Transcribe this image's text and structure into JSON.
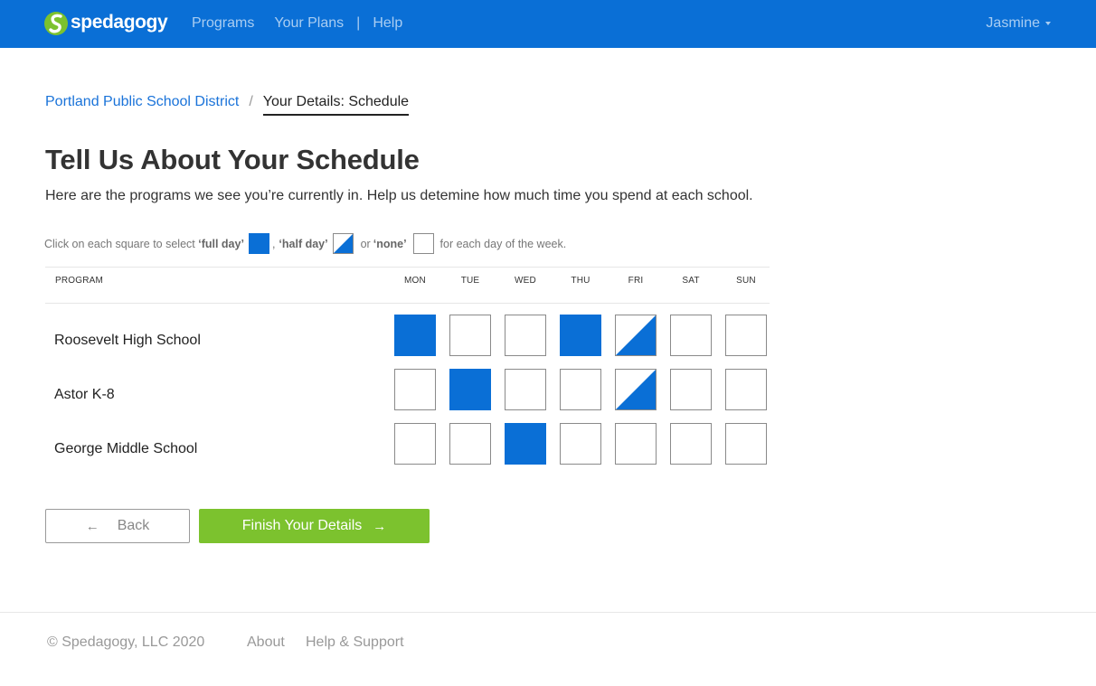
{
  "brand": {
    "name": "spedagogy",
    "color": "#0a6fd6",
    "icon": "spedagogy-logo-icon"
  },
  "nav": {
    "programs": "Programs",
    "plans": "Your Plans",
    "separator": "|",
    "help": "Help"
  },
  "user": {
    "name": "Jasmine"
  },
  "breadcrumb": {
    "district": "Portland Public School District",
    "separator": "/",
    "current": "Your Details: Schedule"
  },
  "page": {
    "title": "Tell Us About Your Schedule",
    "subtitle": "Here are the programs we see you’re currently in. Help us detemine how much time you spend at each school."
  },
  "legend": {
    "prefix": "Click on each square to select ",
    "full_label": "‘full day’",
    "comma": ",",
    "half_label": "‘half day’",
    "or": "or",
    "none_label": "‘none’",
    "suffix": "for each day of the week."
  },
  "table": {
    "program_header": "PROGRAM",
    "days": [
      "MON",
      "TUE",
      "WED",
      "THU",
      "FRI",
      "SAT",
      "SUN"
    ],
    "rows": [
      {
        "program": "Roosevelt High School",
        "schedule": [
          "full",
          "none",
          "none",
          "full",
          "half",
          "none",
          "none"
        ]
      },
      {
        "program": "Astor K-8",
        "schedule": [
          "none",
          "full",
          "none",
          "none",
          "half",
          "none",
          "none"
        ]
      },
      {
        "program": "George Middle School",
        "schedule": [
          "none",
          "none",
          "full",
          "none",
          "none",
          "none",
          "none"
        ]
      }
    ]
  },
  "buttons": {
    "back": "Back",
    "back_icon": "arrow-left-icon",
    "finish": "Finish Your Details",
    "finish_icon": "arrow-right-icon",
    "finish_color": "#7cc22e"
  },
  "footer": {
    "copyright": "© Spedagogy, LLC 2020",
    "about": "About",
    "help_support": "Help & Support"
  }
}
